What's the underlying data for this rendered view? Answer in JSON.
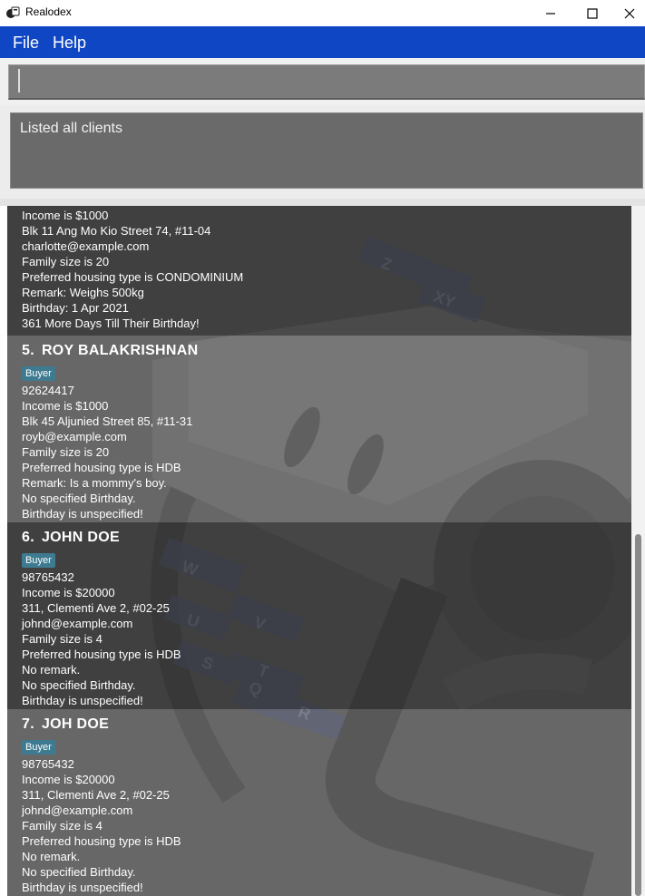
{
  "window": {
    "title": "Realodex"
  },
  "menu": {
    "file": "File",
    "help": "Help"
  },
  "command": {
    "value": "",
    "placeholder": ""
  },
  "result": {
    "message": "Listed all clients"
  },
  "partial_card": {
    "lines": [
      "Income is $1000",
      "Blk 11 Ang Mo Kio Street 74, #11-04",
      "charlotte@example.com",
      "Family size is 20",
      "Preferred housing type is CONDOMINIUM",
      "Remark: Weighs 500kg",
      "Birthday: 1 Apr 2021",
      "361 More Days Till Their Birthday!"
    ]
  },
  "clients": [
    {
      "index": "5.",
      "name": "ROY BALAKRISHNAN",
      "tag": "Buyer",
      "phone": "92624417",
      "income": "Income is $1000",
      "address": "Blk 45 Aljunied Street 85, #11-31",
      "email": "royb@example.com",
      "family": "Family size is 20",
      "housing": "Preferred housing type is HDB",
      "remark": "Remark: Is a mommy's boy.",
      "birthday": "No specified Birthday.",
      "countdown": "Birthday is unspecified!"
    },
    {
      "index": "6.",
      "name": "JOHN DOE",
      "tag": "Buyer",
      "phone": "98765432",
      "income": "Income is $20000",
      "address": "311, Clementi Ave 2, #02-25",
      "email": "johnd@example.com",
      "family": "Family size is 4",
      "housing": "Preferred housing type is HDB",
      "remark": "No remark.",
      "birthday": "No specified Birthday.",
      "countdown": "Birthday is unspecified!"
    },
    {
      "index": "7.",
      "name": "JOH DOE",
      "tag": "Buyer",
      "phone": "98765432",
      "income": "Income is $20000",
      "address": "311, Clementi Ave 2, #02-25",
      "email": "johnd@example.com",
      "family": "Family size is 4",
      "housing": "Preferred housing type is HDB",
      "remark": "No remark.",
      "birthday": "No specified Birthday.",
      "countdown": "Birthday is unspecified!"
    }
  ],
  "colors": {
    "menubar": "#0f46c3",
    "tag": "#3e7b91",
    "panel": "#5c5c5c"
  }
}
